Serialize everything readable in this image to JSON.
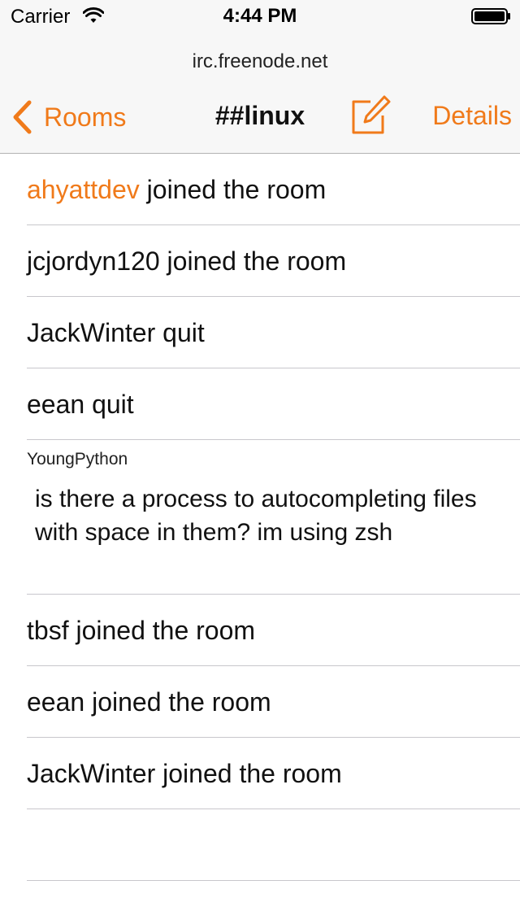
{
  "status_bar": {
    "carrier": "Carrier",
    "time": "4:44 PM"
  },
  "nav": {
    "server": "irc.freenode.net",
    "back_label": "Rooms",
    "title": "##linux",
    "details_label": "Details",
    "accent_color": "#f07a1a"
  },
  "events": [
    {
      "nick": "ahyattdev",
      "text": " joined the room"
    },
    {
      "text": "jcjordyn120 joined the room"
    },
    {
      "text": "JackWinter quit"
    },
    {
      "text": "eean quit"
    }
  ],
  "message": {
    "author": "YoungPython",
    "text": "is there a process to autocompleting files with space in them? im using zsh"
  },
  "events_after": [
    {
      "text": "tbsf joined the room"
    },
    {
      "text": "eean joined the room"
    },
    {
      "text": "JackWinter joined the room"
    }
  ],
  "icons": {
    "back": "chevron-left-icon",
    "compose": "compose-icon",
    "wifi": "wifi-icon",
    "battery": "battery-icon"
  }
}
